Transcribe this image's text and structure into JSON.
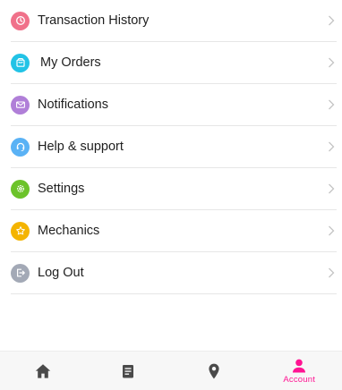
{
  "menu": {
    "items": [
      {
        "label": "Transaction History",
        "icon": "clock-icon",
        "color": "#f0718a"
      },
      {
        "label": "My Orders",
        "icon": "bag-icon",
        "color": "#22c3e6"
      },
      {
        "label": "Notifications",
        "icon": "envelope-icon",
        "color": "#b07fd8"
      },
      {
        "label": "Help & support",
        "icon": "headset-icon",
        "color": "#5ab2f5"
      },
      {
        "label": "Settings",
        "icon": "gear-icon",
        "color": "#6cc32a"
      },
      {
        "label": "Mechanics",
        "icon": "star-icon",
        "color": "#f4b400"
      },
      {
        "label": "Log Out",
        "icon": "logout-icon",
        "color": "#a3a9b6"
      }
    ]
  },
  "tabbar": {
    "tabs": [
      {
        "name": "home",
        "icon": "home-icon",
        "active": false
      },
      {
        "name": "orders",
        "icon": "document-icon",
        "active": false
      },
      {
        "name": "location",
        "icon": "location-pin-icon",
        "active": false
      },
      {
        "name": "account",
        "icon": "user-icon",
        "active": true,
        "label": "Account"
      }
    ],
    "active_color": "#ff1493",
    "inactive_color": "#4a4a4a"
  }
}
